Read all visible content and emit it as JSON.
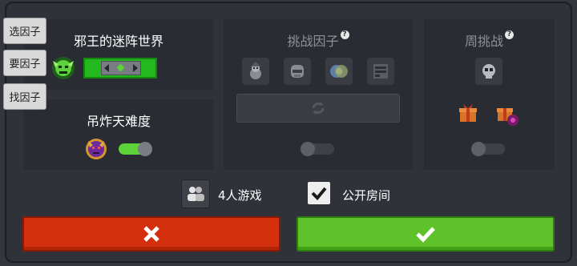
{
  "side_tabs": [
    "选因子",
    "要因子",
    "找因子"
  ],
  "panels": {
    "evil_world": {
      "title": "邪王的迷阵世界"
    },
    "hell_difficulty": {
      "title": "吊炸天难度",
      "enabled": true
    },
    "challenge_factors": {
      "title": "挑战因子",
      "enabled": false,
      "icons": [
        "snowman-mage-icon",
        "helmet-knight-icon",
        "globe-icon",
        "mine-cart-icon"
      ]
    },
    "weekly_challenge": {
      "title": "周挑战",
      "enabled": false,
      "icons": [
        "skull-icon",
        "gift-box-icon",
        "cursed-gift-icon"
      ]
    }
  },
  "options": {
    "multiplayer": {
      "label": "4人游戏"
    },
    "public_room": {
      "label": "公开房间",
      "checked": true
    }
  },
  "buttons": {
    "cancel_icon": "close-icon",
    "confirm_icon": "check-icon"
  },
  "colors": {
    "cancel": "#d4300e",
    "confirm": "#5fc22a",
    "toggle_on": "#5bd339"
  }
}
